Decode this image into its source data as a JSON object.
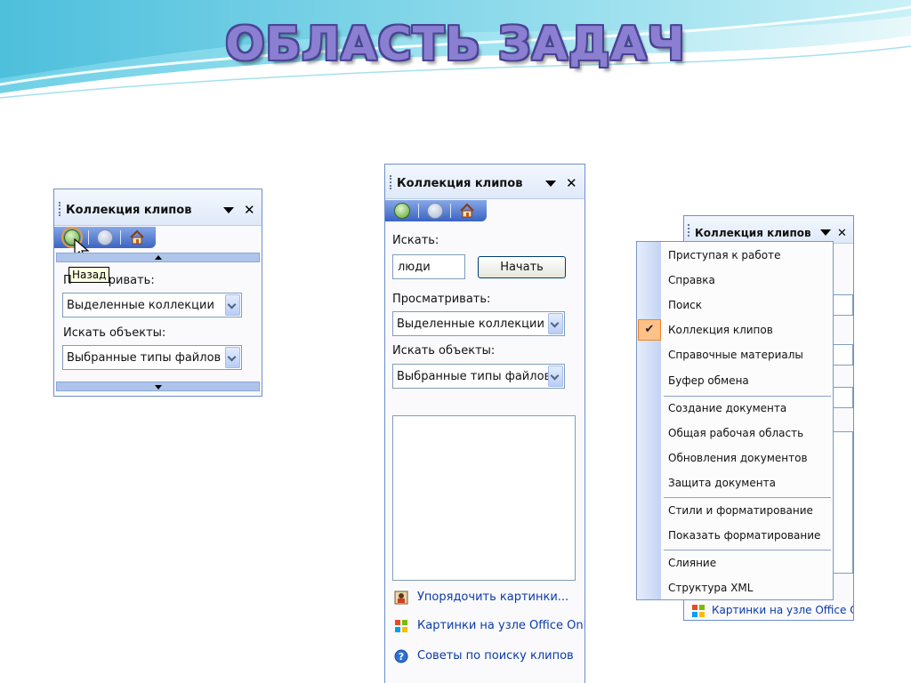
{
  "slide": {
    "title": "ОБЛАСТЬ ЗАДАЧ",
    "accent_color": "#8a7fd0",
    "outline_color": "#4b4396",
    "bg_wave_color": "#5ec8e0"
  },
  "pane1": {
    "title": "Коллекция клипов",
    "nav": {
      "back_icon": "back-arrow-icon",
      "forward_icon": "forward-arrow-icon",
      "home_icon": "home-icon"
    },
    "tooltip": "Назад",
    "browse_label": "Просматривать:",
    "browse_label_tail": "ривать:",
    "browse_label_head": "П",
    "browse_value": "Выделенные коллекции",
    "objects_label": "Искать объекты:",
    "objects_value": "Выбранные типы файлов м"
  },
  "pane2": {
    "title": "Коллекция клипов",
    "search_label": "Искать:",
    "search_value": "люди",
    "go_button": "Начать",
    "browse_label": "Просматривать:",
    "browse_value": "Выделенные коллекции",
    "objects_label": "Искать объекты:",
    "objects_value": "Выбранные типы файлов",
    "links": [
      {
        "label": "Упорядочить картинки...",
        "icon": "organizer-icon"
      },
      {
        "label": "Картинки на узле Office Onli",
        "icon": "office-online-icon"
      },
      {
        "label": "Советы по поиску клипов",
        "icon": "help-icon"
      }
    ]
  },
  "pane3": {
    "title": "Коллекция клипов",
    "footer_link": "Картинки на узле Office Onli",
    "footer_icon": "office-online-icon"
  },
  "menu": {
    "checked_item": "Коллекция клипов",
    "groups": [
      [
        "Приступая к работе",
        "Справка",
        "Поиск",
        "Коллекция клипов",
        "Справочные материалы",
        "Буфер обмена"
      ],
      [
        "Создание документа",
        "Общая рабочая область",
        "Обновления документов",
        "Защита документа"
      ],
      [
        "Стили и форматирование",
        "Показать форматирование"
      ],
      [
        "Слияние",
        "Структура XML"
      ]
    ]
  }
}
